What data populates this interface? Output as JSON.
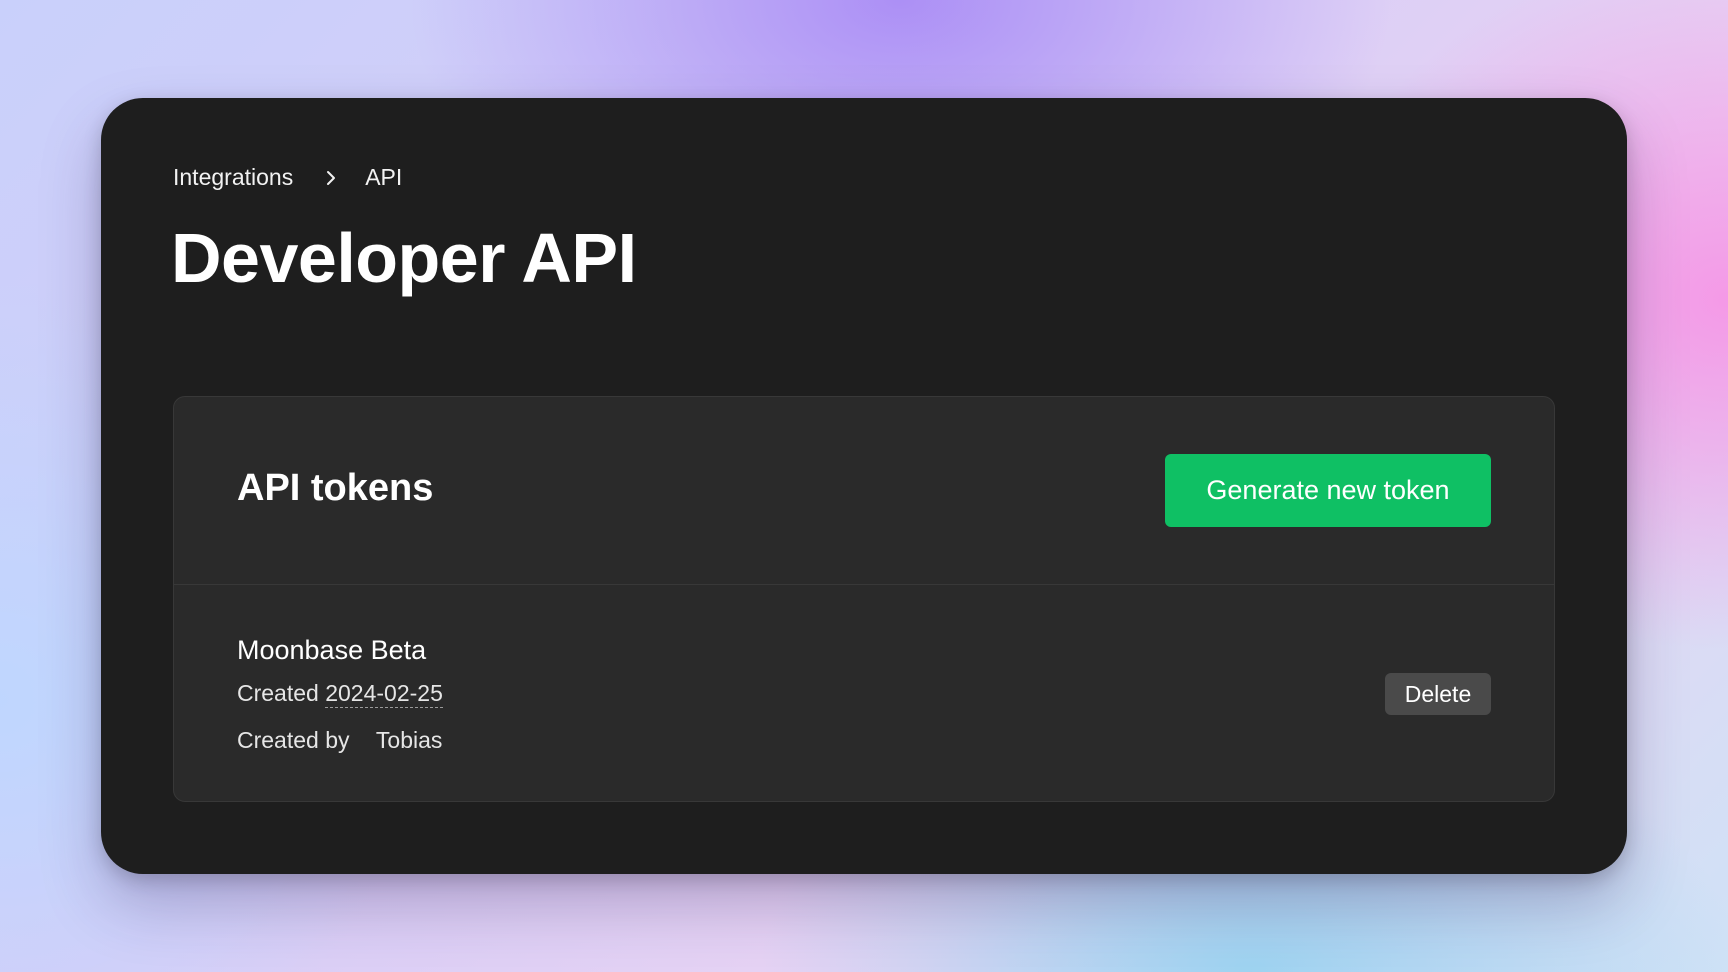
{
  "breadcrumb": {
    "items": [
      "Integrations",
      "API"
    ]
  },
  "page": {
    "title": "Developer API"
  },
  "tokens_card": {
    "title": "API tokens",
    "generate_button_label": "Generate new token",
    "tokens": [
      {
        "name": "Moonbase Beta",
        "created_label": "Created",
        "created_date": "2024-02-25",
        "created_by_label": "Created by",
        "created_by": "Tobias",
        "delete_label": "Delete"
      }
    ]
  },
  "colors": {
    "window_background": "#1e1e1e",
    "card_background": "#2a2a2a",
    "primary_button": "#0fc064",
    "secondary_button": "#4a4a4a"
  },
  "icons": {
    "breadcrumb_separator": "chevron-right-icon"
  }
}
